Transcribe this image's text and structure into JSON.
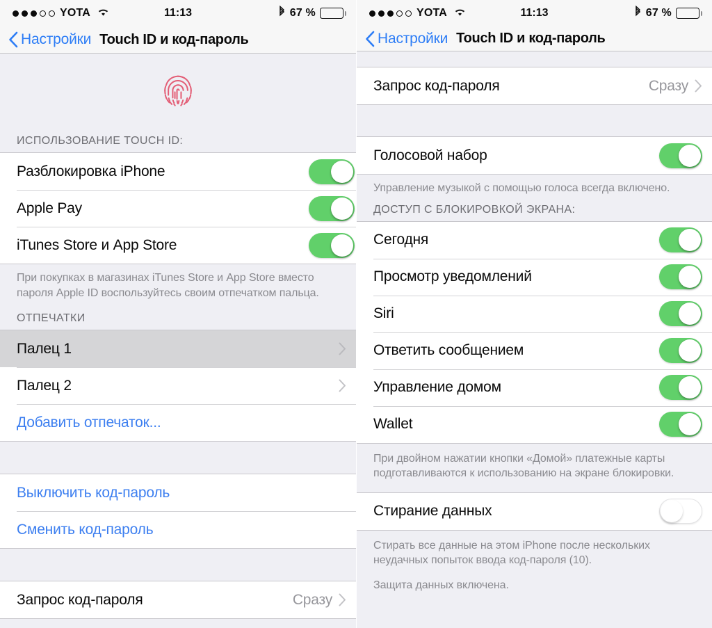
{
  "status_bar": {
    "carrier": "YOTA",
    "signal_dots_filled": 3,
    "signal_dots_total": 5,
    "wifi_icon": "wifi-icon",
    "time": "11:13",
    "bluetooth_icon": "bluetooth-icon",
    "battery_label": "67 %",
    "battery_percent": 67
  },
  "nav": {
    "back_label": "Настройки",
    "title": "Touch ID и код-пароль",
    "back_icon": "chevron-left-icon"
  },
  "left_screen": {
    "hero_icon": "fingerprint-icon",
    "hero_color": "#e55a72",
    "section_touchid_header": "ИСПОЛЬЗОВАНИЕ TOUCH ID:",
    "touchid_rows": [
      {
        "label": "Разблокировка iPhone",
        "toggle": "on"
      },
      {
        "label": "Apple Pay",
        "toggle": "on"
      },
      {
        "label": "iTunes Store и App Store",
        "toggle": "on"
      }
    ],
    "touchid_footer": "При покупках в магазинах iTunes Store и App Store вместо пароля Apple ID воспользуйтесь своим отпечатком пальца.",
    "section_prints_header": "ОТПЕЧАТКИ",
    "print_rows": [
      {
        "label": "Палец 1",
        "chevron": "chevron-right-icon",
        "pressed": true
      },
      {
        "label": "Палец 2",
        "chevron": "chevron-right-icon",
        "pressed": false
      }
    ],
    "add_print_label": "Добавить отпечаток...",
    "passcode_actions": [
      {
        "label": "Выключить код-пароль"
      },
      {
        "label": "Сменить код-пароль"
      }
    ],
    "passcode_request": {
      "label": "Запрос код-пароля",
      "value": "Сразу",
      "chevron": "chevron-right-icon"
    }
  },
  "right_screen": {
    "passcode_request": {
      "label": "Запрос код-пароля",
      "value": "Сразу",
      "chevron": "chevron-right-icon"
    },
    "voice_dial": {
      "label": "Голосовой набор",
      "toggle": "on"
    },
    "voice_dial_footer": "Управление музыкой с помощью голоса всегда включено.",
    "section_lock_header": "ДОСТУП С БЛОКИРОВКОЙ ЭКРАНА:",
    "lock_rows": [
      {
        "label": "Сегодня",
        "toggle": "on"
      },
      {
        "label": "Просмотр уведомлений",
        "toggle": "on"
      },
      {
        "label": "Siri",
        "toggle": "on"
      },
      {
        "label": "Ответить сообщением",
        "toggle": "on"
      },
      {
        "label": "Управление домом",
        "toggle": "on"
      },
      {
        "label": "Wallet",
        "toggle": "on"
      }
    ],
    "lock_footer": "При двойном нажатии кнопки «Домой» платежные карты подготавливаются к использованию на экране блокировки.",
    "erase_row": {
      "label": "Стирание данных",
      "toggle": "off"
    },
    "erase_footer_1": "Стирать все данные на этом iPhone после нескольких неудачных попыток ввода код-пароля (10).",
    "erase_footer_2": "Защита данных включена."
  }
}
